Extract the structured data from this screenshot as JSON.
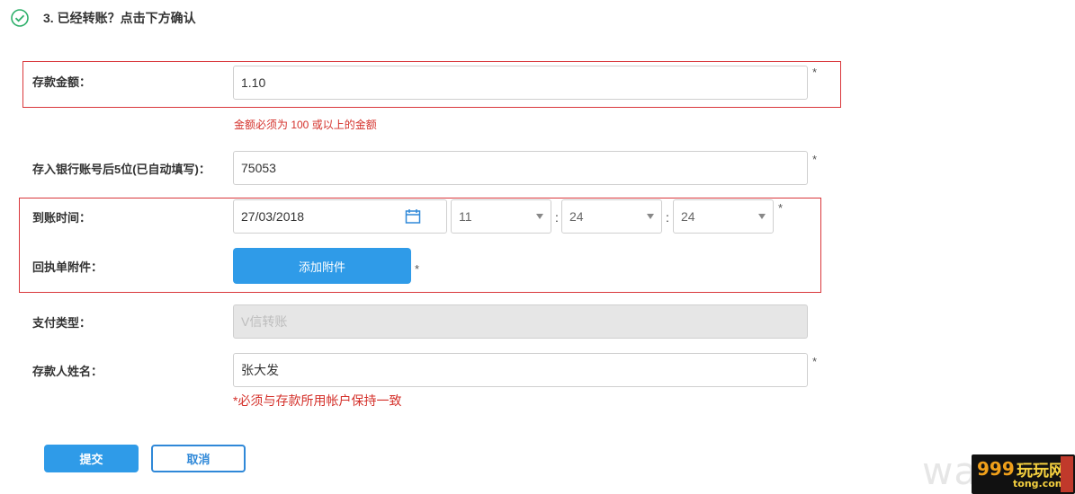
{
  "step": {
    "title": "3. 已经转账？点击下方确认"
  },
  "amount": {
    "label": "存款金额：",
    "value": "1.10",
    "required": "*",
    "error": "金额必须为 100 或以上的金额"
  },
  "bank_account": {
    "label": "存入银行账号后5位(已自动填写)：",
    "value": "75053",
    "required": "*"
  },
  "arrival_time": {
    "label": "到账时间：",
    "date": "27/03/2018",
    "hour": "11",
    "minute": "24",
    "second": "24",
    "sep1": ":",
    "sep2": ":",
    "required": "*"
  },
  "attachment": {
    "label": "回执单附件：",
    "button": "添加附件",
    "required": "*"
  },
  "payment_type": {
    "label": "支付类型：",
    "placeholder": "V信转账"
  },
  "depositor": {
    "label": "存款人姓名：",
    "value": "张大发",
    "required": "*",
    "note": "*必须与存款所用帐户保持一致"
  },
  "actions": {
    "submit": "提交",
    "cancel": "取消"
  },
  "watermark": {
    "text": "wa",
    "logo_main": "999",
    "logo_play": "玩玩网",
    "logo_sub": "tong.com"
  },
  "colors": {
    "accent": "#2f9be8",
    "error": "#d4302a",
    "highlight": "#d9373b",
    "success": "#2fb06b"
  }
}
